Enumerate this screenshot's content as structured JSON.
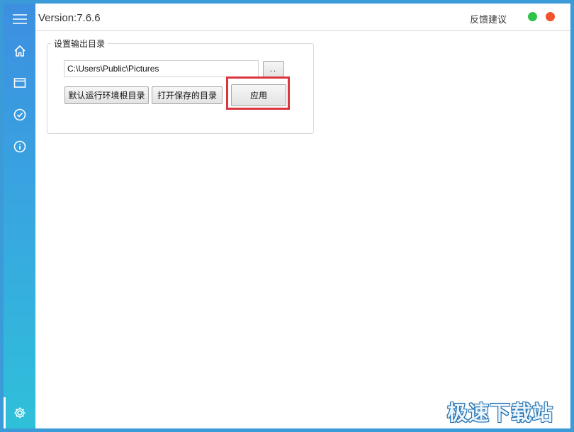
{
  "header": {
    "version": "Version:7.6.6",
    "feedback": "反馈建议",
    "status_colors": {
      "green": "#2ec44a",
      "red": "#f0522d"
    }
  },
  "sidebar": {
    "items": [
      {
        "icon": "menu-icon"
      },
      {
        "icon": "home-icon"
      },
      {
        "icon": "window-icon"
      },
      {
        "icon": "check-circle-icon"
      },
      {
        "icon": "info-icon"
      },
      {
        "icon": "gear-icon"
      }
    ],
    "accent": "#3d8fe0"
  },
  "settings": {
    "group_title": "设置输出目录",
    "path_value": "C:\\Users\\Public\\Pictures",
    "browse_label": "..",
    "default_dir_label": "默认运行环境根目录",
    "open_dir_label": "打开保存的目录",
    "apply_label": "应用",
    "highlight_color": "#d9363e"
  },
  "watermark": {
    "text": "极速下载站"
  }
}
